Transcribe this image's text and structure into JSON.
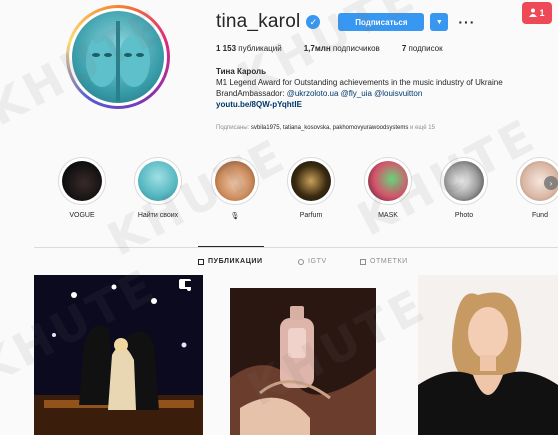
{
  "profile": {
    "username": "tina_karol",
    "follow_label": "Подписаться",
    "notification_count": "1",
    "stats": [
      {
        "value": "1 153",
        "label": "публикаций"
      },
      {
        "value": "1,7млн",
        "label": "подписчиков"
      },
      {
        "value": "7",
        "label": "подписок"
      }
    ],
    "bio": {
      "name": "Тина Кароль",
      "line1": "M1 Legend Award for Outstanding achievements in the music industry of Ukraine",
      "line2_prefix": "BrandAmbassador: ",
      "mention1": "@ukrzoloto.ua",
      "mention2": "@fly_uia",
      "mention3": "@louisvuitton",
      "url": "youtu.be/8QW-pYqhtIE"
    },
    "followed_by": {
      "prefix": "Подписаны: ",
      "names": "svbila1975, tatiana_kosovska, pakhomovyurawoodsystems",
      "suffix": " и ещё 15"
    }
  },
  "stories": [
    {
      "label": "VOGUE"
    },
    {
      "label": "Найти своих"
    },
    {
      "label": "🎙"
    },
    {
      "label": "Parfum"
    },
    {
      "label": "MASK"
    },
    {
      "label": "Photo"
    },
    {
      "label": "Fund"
    }
  ],
  "tabs": [
    {
      "label": "ПУБЛИКАЦИИ"
    },
    {
      "label": "IGTV"
    },
    {
      "label": "ОТМЕТКИ"
    }
  ],
  "watermark": "KHUTE",
  "colors": {
    "accent": "#3897f0",
    "badge": "#ed4956",
    "link": "#00376b"
  }
}
